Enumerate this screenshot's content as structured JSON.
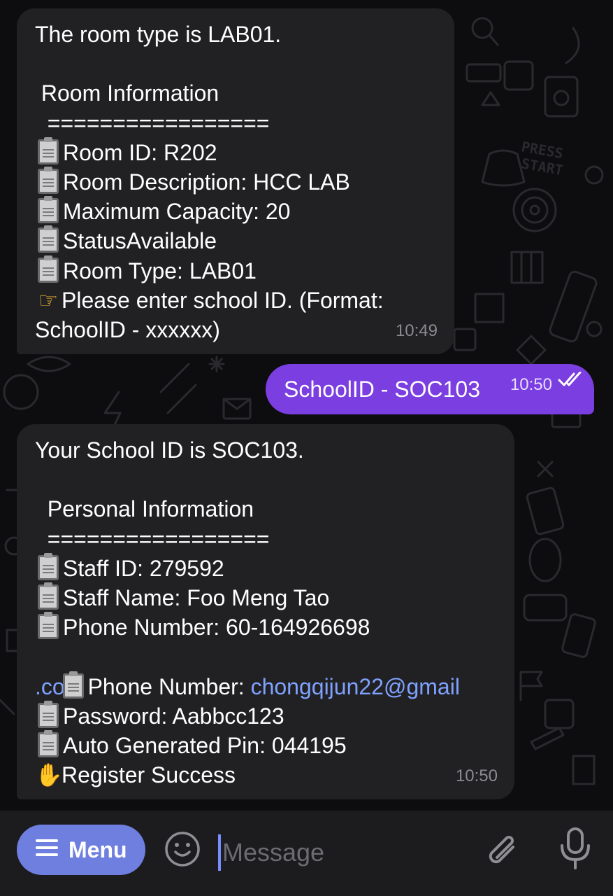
{
  "incoming_room": {
    "lines": [
      {
        "icon": "",
        "text": "The room type is LAB01."
      },
      {
        "icon": "",
        "text": ""
      },
      {
        "icon": "",
        "text": " Room Information"
      },
      {
        "icon": "",
        "text": "  ================="
      },
      {
        "icon": "clipboard-icon",
        "text": "Room ID: R202"
      },
      {
        "icon": "clipboard-icon",
        "text": "Room Description: HCC LAB"
      },
      {
        "icon": "clipboard-icon",
        "text": "Maximum Capacity: 20"
      },
      {
        "icon": "clipboard-icon",
        "text": "StatusAvailable"
      },
      {
        "icon": "clipboard-icon",
        "text": "Room Type: LAB01"
      },
      {
        "icon": "pointing-hand-icon",
        "text": "Please enter school ID. (Format:"
      }
    ],
    "last_line": "SchoolID - xxxxxx)",
    "time": "10:49"
  },
  "outgoing": {
    "text": "SchoolID - SOC103",
    "time": "10:50",
    "status_icon": "double-check-icon"
  },
  "incoming_personal": {
    "lines": [
      {
        "icon": "",
        "text": "Your School ID is SOC103."
      },
      {
        "icon": "",
        "text": ""
      },
      {
        "icon": "",
        "text": "  Personal Information"
      },
      {
        "icon": "",
        "text": "  ================="
      },
      {
        "icon": "clipboard-icon",
        "text": "Staff ID: 279592"
      },
      {
        "icon": "clipboard-icon",
        "text": "Staff Name: Foo Meng Tao"
      },
      {
        "icon": "clipboard-icon",
        "text": "Phone Number: 60-164926698"
      }
    ],
    "email_line": {
      "icon": "clipboard-icon",
      "label": "Phone Number: ",
      "email": "chongqijun22@gmail",
      "email_tail": ".com"
    },
    "lines_after": [
      {
        "icon": "clipboard-icon",
        "text": "Password: Aabbcc123"
      },
      {
        "icon": "clipboard-icon",
        "text": "Auto Generated Pin: 044195"
      },
      {
        "icon": "clapping-hands-icon",
        "text": "Register Success"
      }
    ],
    "time": "10:50"
  },
  "bottom": {
    "menu_label": "Menu",
    "placeholder": "Message",
    "accent": "#6f7fe0"
  },
  "colors": {
    "background": "#0d0d0f",
    "incoming_bubble": "#212124",
    "outgoing_bubble": "#7b3ee0",
    "link": "#7fa2ff"
  }
}
